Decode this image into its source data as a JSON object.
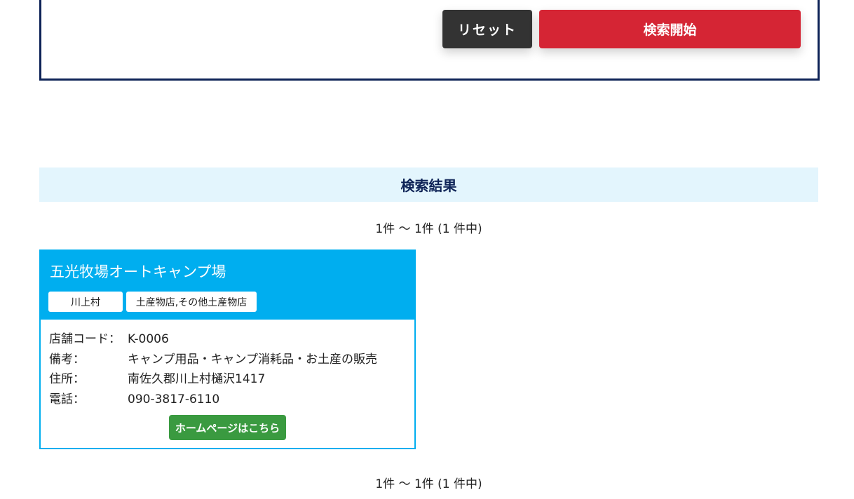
{
  "search": {
    "reset_label": "リセット",
    "submit_label": "検索開始"
  },
  "results": {
    "header": "検索結果",
    "pager_text": "1件 〜 1件 (1 件中)",
    "items": [
      {
        "name": "五光牧場オートキャンプ場",
        "area_tag": "川上村",
        "category_tag": "土産物店,その他土産物店",
        "code_label": "店舗コード：",
        "code": "K-0006",
        "note_label": "備考：",
        "note": "キャンプ用品・キャンプ消耗品・お土産の販売",
        "address_label": "住所：",
        "address": "南佐久郡川上村樋沢1417",
        "phone_label": "電話：",
        "phone": "090-3817-6110",
        "homepage_label": "ホームページはこちら"
      }
    ]
  },
  "colors": {
    "navy": "#0e2357",
    "accent_red": "#d52534",
    "card_blue": "#00aeef",
    "header_bg": "#e3f5fd",
    "homepage_green": "#3a9a40"
  }
}
